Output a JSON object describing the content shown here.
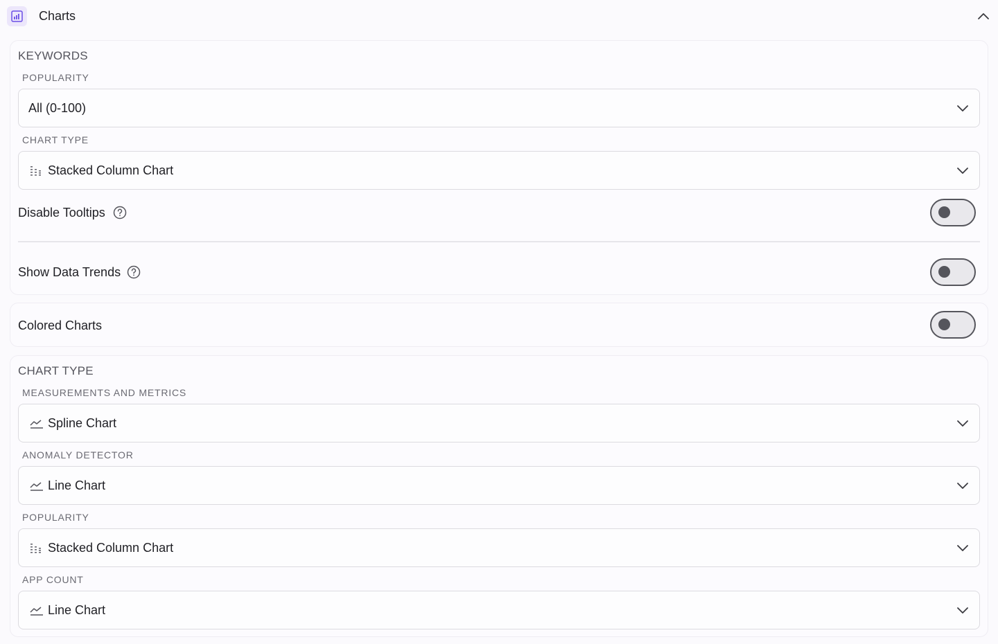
{
  "header": {
    "title": "Charts",
    "icon": "bar-chart-icon",
    "collapse_icon": "chevron-up-icon",
    "accent": "#6b4ee6"
  },
  "keywords": {
    "section_title": "KEYWORDS",
    "popularity_label": "POPULARITY",
    "popularity_value": "All (0-100)",
    "chart_type_label": "CHART TYPE",
    "chart_type_value": "Stacked Column Chart",
    "chart_type_icon": "stacked-column-icon",
    "disable_tooltips_label": "Disable Tooltips",
    "disable_tooltips_on": false,
    "show_trends_label": "Show Data Trends",
    "show_trends_on": false
  },
  "colored": {
    "label": "Colored Charts",
    "on": false
  },
  "chart_type_section": {
    "section_title": "CHART TYPE",
    "fields": [
      {
        "label": "MEASUREMENTS AND METRICS",
        "value": "Spline Chart",
        "icon": "line-chart-icon"
      },
      {
        "label": "ANOMALY DETECTOR",
        "value": "Line Chart",
        "icon": "line-chart-icon"
      },
      {
        "label": "POPULARITY",
        "value": "Stacked Column Chart",
        "icon": "stacked-column-icon"
      },
      {
        "label": "APP COUNT",
        "value": "Line Chart",
        "icon": "line-chart-icon"
      }
    ]
  },
  "icons": {
    "dropdown": "chevron-down-icon",
    "help": "question-circle-icon"
  }
}
